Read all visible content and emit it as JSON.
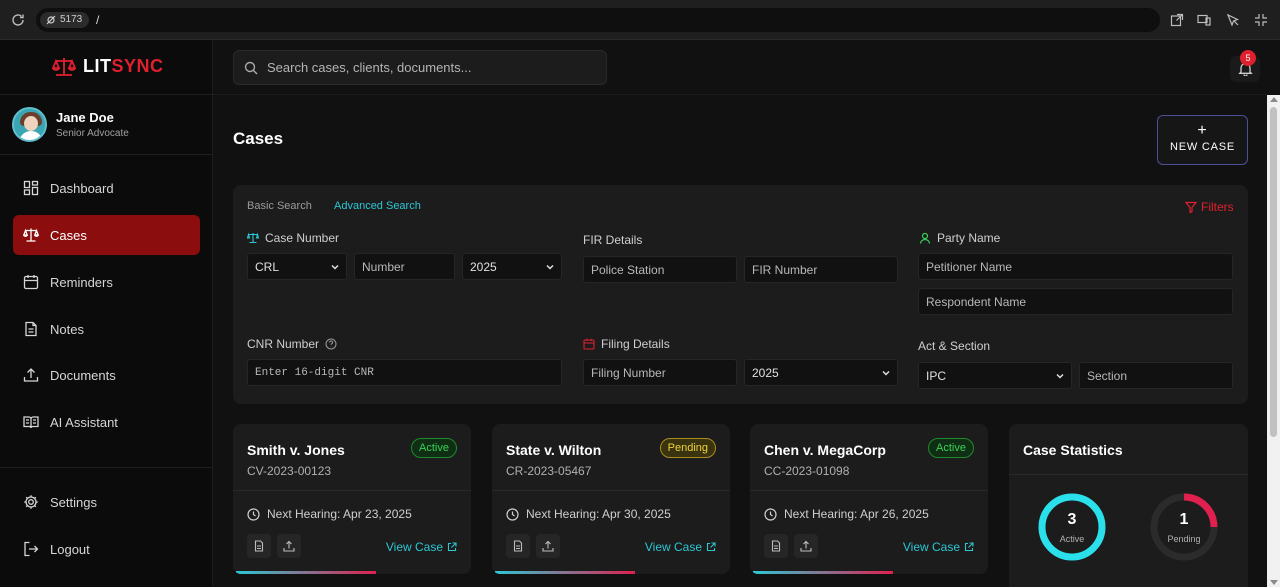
{
  "browser": {
    "port": "5173",
    "path": "/"
  },
  "brand": {
    "lit": "LIT",
    "sync": "SYNC"
  },
  "user": {
    "name": "Jane Doe",
    "role": "Senior Advocate"
  },
  "nav": {
    "items": [
      {
        "label": "Dashboard",
        "icon": "dashboard-icon"
      },
      {
        "label": "Cases",
        "icon": "scales-icon",
        "active": true
      },
      {
        "label": "Reminders",
        "icon": "calendar-icon"
      },
      {
        "label": "Notes",
        "icon": "note-icon"
      },
      {
        "label": "Documents",
        "icon": "upload-icon"
      },
      {
        "label": "AI Assistant",
        "icon": "book-icon"
      }
    ],
    "bottom": [
      {
        "label": "Settings",
        "icon": "gear-icon"
      },
      {
        "label": "Logout",
        "icon": "logout-icon"
      }
    ]
  },
  "search": {
    "placeholder": "Search cases, clients, documents..."
  },
  "notifications": {
    "count": "5"
  },
  "page": {
    "title": "Cases",
    "new_case_label": "NEW CASE"
  },
  "panel": {
    "tabs": {
      "basic": "Basic Search",
      "advanced": "Advanced Search"
    },
    "filters_label": "Filters",
    "case_number": {
      "label": "Case Number",
      "type": "CRL",
      "number_placeholder": "Number",
      "year": "2025"
    },
    "fir": {
      "label": "FIR Details",
      "station_placeholder": "Police Station",
      "number_placeholder": "FIR Number"
    },
    "party": {
      "label": "Party Name",
      "petitioner_placeholder": "Petitioner Name",
      "respondent_placeholder": "Respondent Name"
    },
    "cnr": {
      "label": "CNR Number",
      "placeholder": "Enter 16-digit CNR"
    },
    "filing": {
      "label": "Filing Details",
      "number_placeholder": "Filing Number",
      "year": "2025"
    },
    "act": {
      "label": "Act & Section",
      "act": "IPC",
      "section_placeholder": "Section"
    }
  },
  "cases": [
    {
      "title": "Smith v. Jones",
      "number": "CV-2023-00123",
      "status": "Active",
      "hearing": "Next Hearing: Apr 23, 2025",
      "view": "View Case"
    },
    {
      "title": "State v. Wilton",
      "number": "CR-2023-05467",
      "status": "Pending",
      "hearing": "Next Hearing: Apr 30, 2025",
      "view": "View Case"
    },
    {
      "title": "Chen v. MegaCorp",
      "number": "CC-2023-01098",
      "status": "Active",
      "hearing": "Next Hearing: Apr 26, 2025",
      "view": "View Case"
    }
  ],
  "stats": {
    "title": "Case Statistics",
    "active": {
      "value": "3",
      "label": "Active",
      "color": "#2ae0ea"
    },
    "pending": {
      "value": "1",
      "label": "Pending",
      "color": "#e0204f"
    }
  },
  "colors": {
    "accent": "#e0202f",
    "cyan": "#2cc7d4",
    "active_nav": "#8b0d0d"
  }
}
